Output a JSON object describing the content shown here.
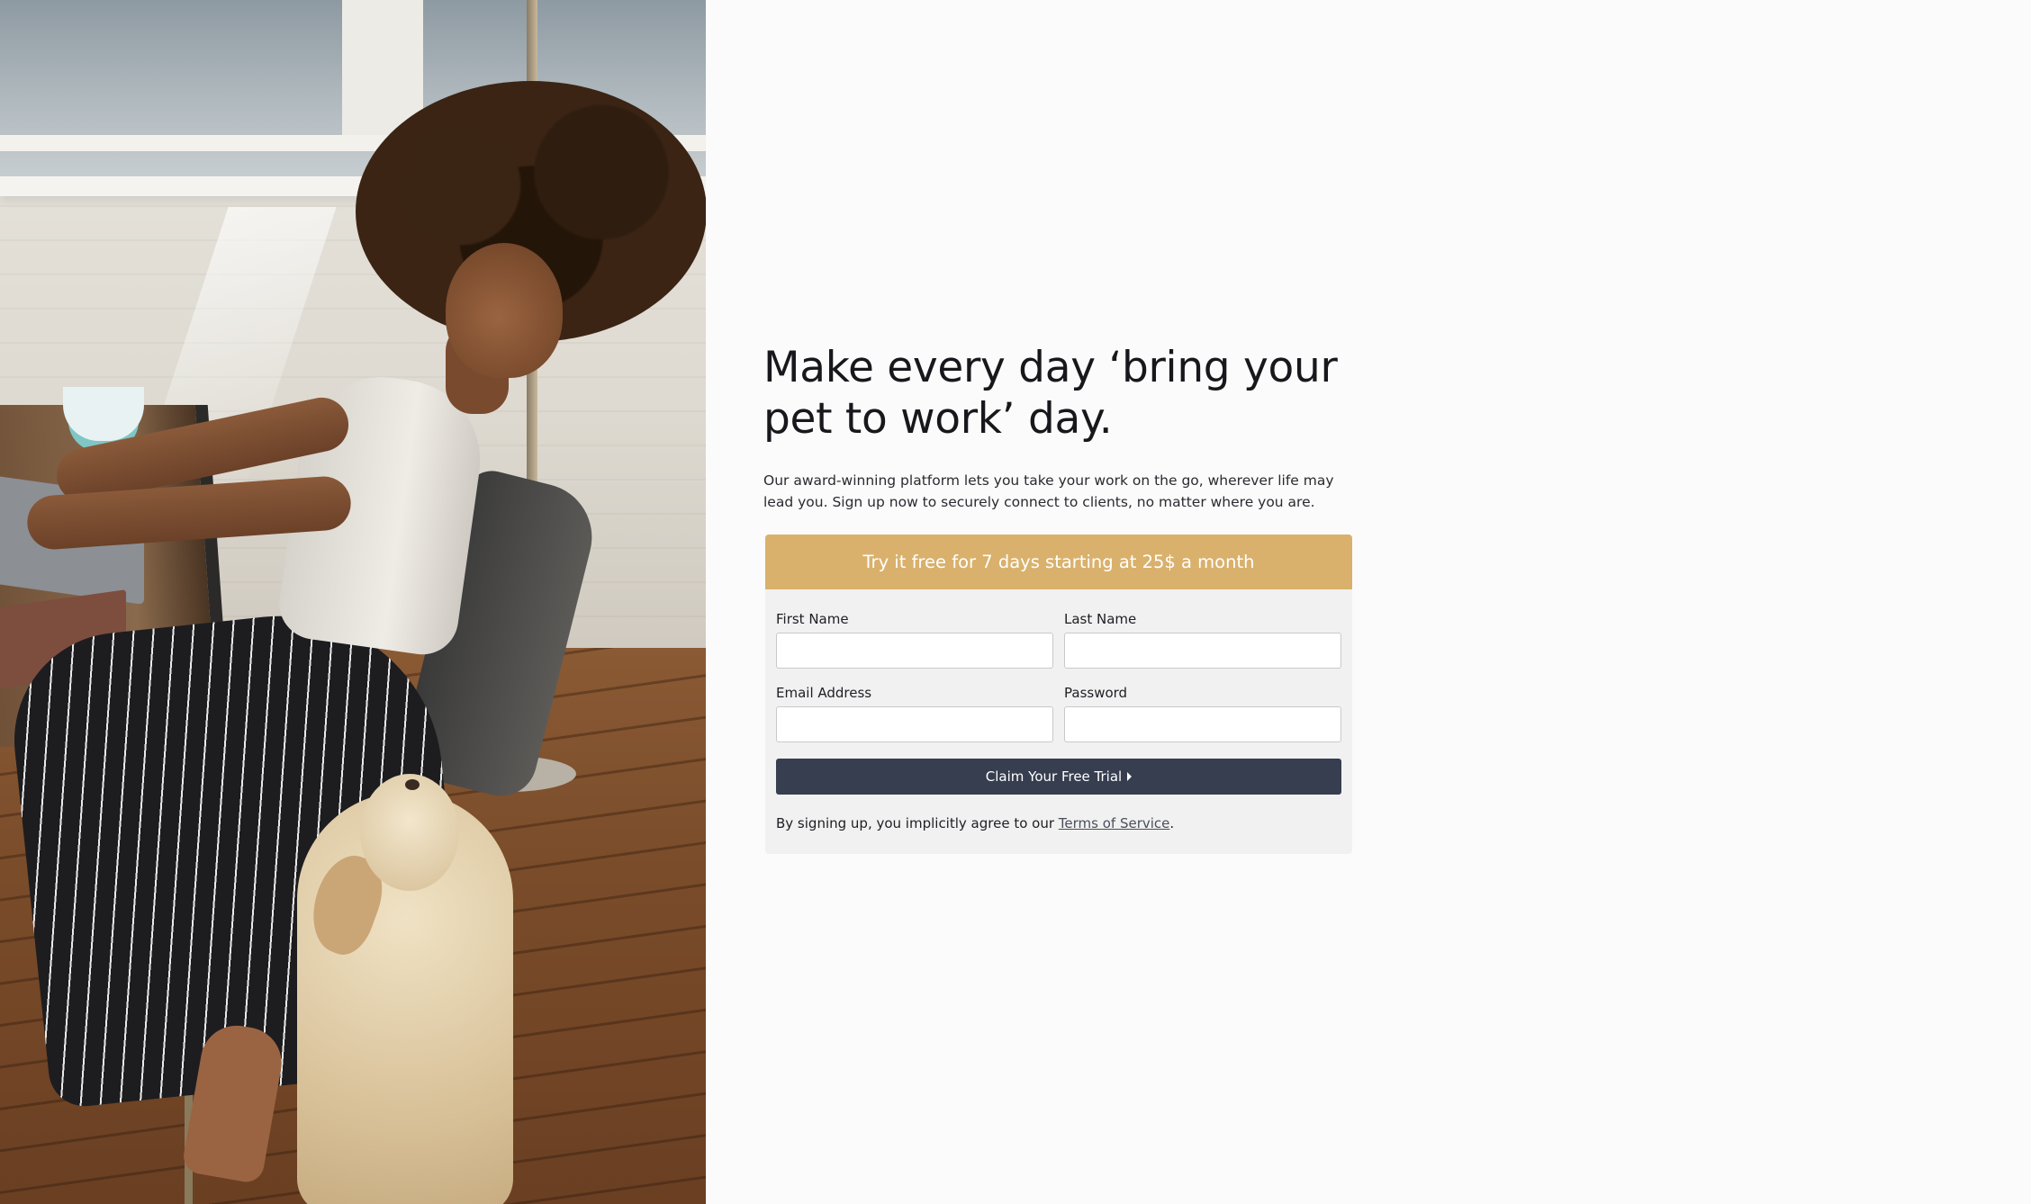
{
  "hero": {
    "headline_line1": "Make every day ‘bring your",
    "headline_line2": "pet to work’ day.",
    "lead": "Our award-winning platform lets you take your work on the go, wherever life may lead you. Sign up now to securely connect to clients, no matter where you are."
  },
  "signup": {
    "banner": "Try it free for 7 days starting at 25$ a month",
    "fields": {
      "first_name": {
        "label": "First Name",
        "value": "",
        "placeholder": ""
      },
      "last_name": {
        "label": "Last Name",
        "value": "",
        "placeholder": ""
      },
      "email": {
        "label": "Email Address",
        "value": "",
        "placeholder": ""
      },
      "password": {
        "label": "Password",
        "value": "",
        "placeholder": ""
      }
    },
    "submit_label": "Claim Your Free Trial",
    "submit_icon": "caret-right-icon",
    "terms_prefix": "By signing up, you implicitly agree to our ",
    "terms_link": "Terms of Service",
    "terms_suffix": "."
  },
  "colors": {
    "banner": "#d9b16c",
    "button": "#363e4f",
    "card": "#f1f1f1",
    "background": "#fbfbfb"
  }
}
